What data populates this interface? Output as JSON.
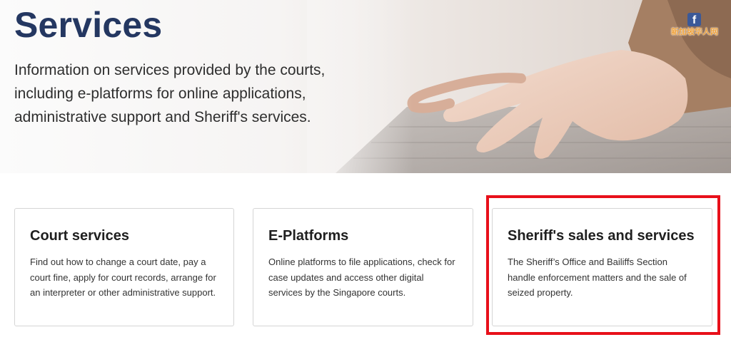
{
  "hero": {
    "title": "Services",
    "intro": "Information on services provided by the courts, including e-platforms for online applications, administrative support and Sheriff's services."
  },
  "badge": {
    "icon": "facebook-icon",
    "icon_glyph": "f",
    "text": "新加坡华人网",
    "colors": {
      "icon_bg": "#3b5998",
      "text": "#f0a23b"
    }
  },
  "cards": [
    {
      "title": "Court services",
      "description": "Find out how to change a court date, pay a court fine, apply for court records, arrange for an interpreter or other administrative support."
    },
    {
      "title": "E-Platforms",
      "description": "Online platforms to file applications, check for case updates and access other digital services by the Singapore courts."
    },
    {
      "title": "Sheriff's sales and services",
      "description": "The Sheriff’s Office and Bailiffs Section handle enforcement matters and the sale of seized property."
    }
  ],
  "colors": {
    "title": "#243761",
    "highlight": "#e8101a"
  }
}
